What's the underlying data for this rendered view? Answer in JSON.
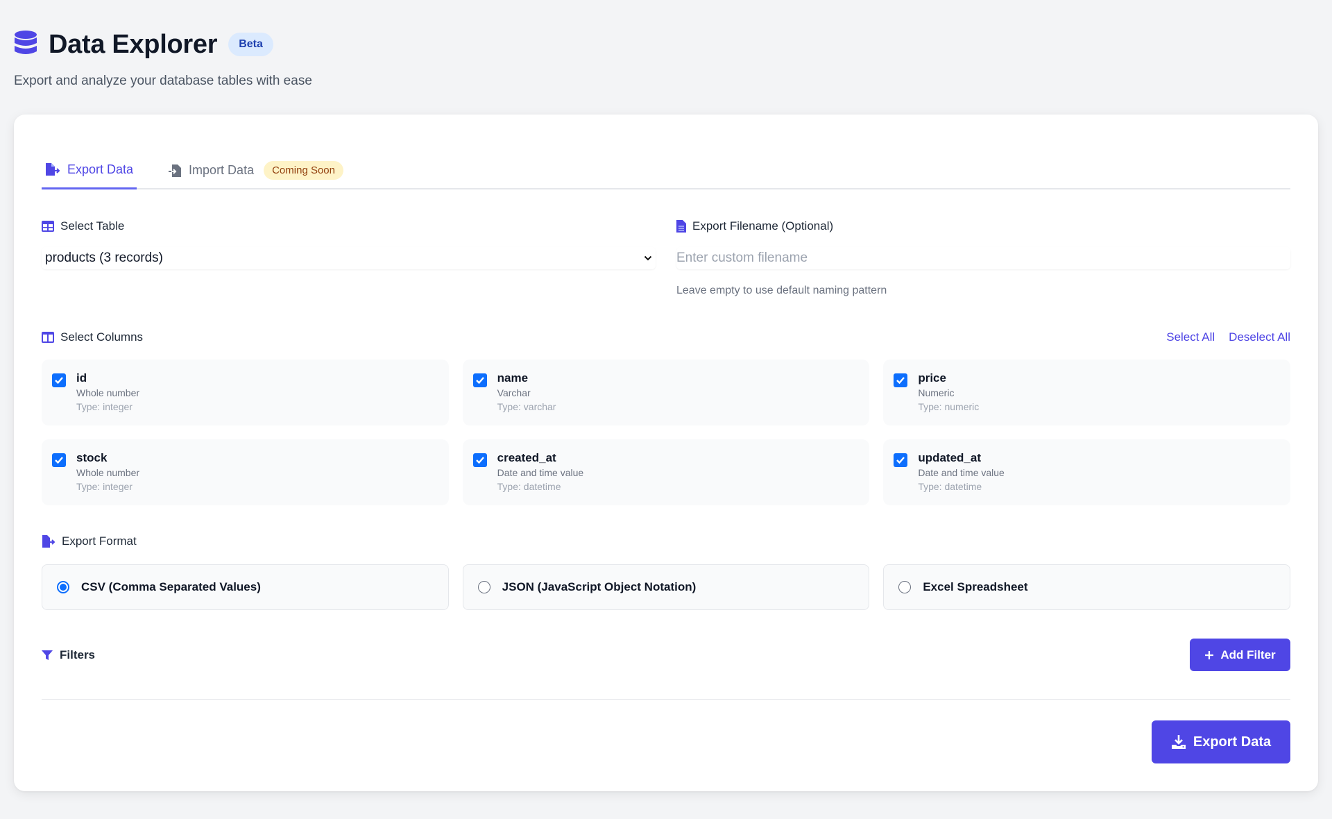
{
  "header": {
    "title": "Data Explorer",
    "badge": "Beta",
    "subtitle": "Export and analyze your database tables with ease",
    "icon": "database-icon"
  },
  "tabs": [
    {
      "label": "Export Data",
      "icon": "file-export-icon",
      "active": true
    },
    {
      "label": "Import Data",
      "icon": "file-import-icon",
      "active": false,
      "badge": "Coming Soon"
    }
  ],
  "select_table": {
    "label": "Select Table",
    "icon": "table-icon",
    "value": "products (3 records)"
  },
  "filename": {
    "label": "Export Filename (Optional)",
    "icon": "file-icon",
    "value": "",
    "placeholder": "Enter custom filename",
    "helper": "Leave empty to use default naming pattern"
  },
  "columns": {
    "label": "Select Columns",
    "icon": "columns-icon",
    "select_all": "Select All",
    "deselect_all": "Deselect All",
    "items": [
      {
        "name": "id",
        "description": "Whole number",
        "type": "Type: integer",
        "checked": true
      },
      {
        "name": "name",
        "description": "Varchar",
        "type": "Type: varchar",
        "checked": true
      },
      {
        "name": "price",
        "description": "Numeric",
        "type": "Type: numeric",
        "checked": true
      },
      {
        "name": "stock",
        "description": "Whole number",
        "type": "Type: integer",
        "checked": true
      },
      {
        "name": "created_at",
        "description": "Date and time value",
        "type": "Type: datetime",
        "checked": true
      },
      {
        "name": "updated_at",
        "description": "Date and time value",
        "type": "Type: datetime",
        "checked": true
      }
    ]
  },
  "format": {
    "label": "Export Format",
    "icon": "file-export-icon",
    "options": [
      {
        "label": "CSV (Comma Separated Values)",
        "selected": true
      },
      {
        "label": "JSON (JavaScript Object Notation)",
        "selected": false
      },
      {
        "label": "Excel Spreadsheet",
        "selected": false
      }
    ]
  },
  "filters": {
    "label": "Filters",
    "icon": "filter-icon",
    "add_label": "Add Filter"
  },
  "export_button": {
    "label": "Export Data",
    "icon": "download-icon"
  },
  "colors": {
    "accent": "#4f46e5",
    "checkbox": "#0d6efd",
    "beta_bg": "#dbeafe",
    "soon_bg": "#fef3c7",
    "page_bg": "#f3f4f6"
  }
}
